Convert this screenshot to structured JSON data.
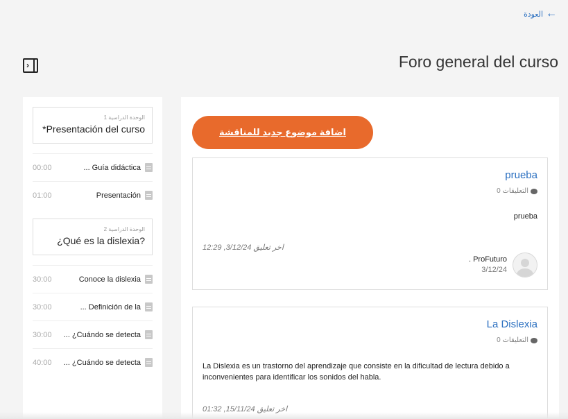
{
  "header": {
    "back_label": "العودة",
    "title": "Foro general del curso"
  },
  "sidebar": {
    "units": [
      {
        "number_label": "الوحدة الدراسية 1",
        "title": "*Presentación del curso",
        "lessons": [
          {
            "name": "... Guía didáctica",
            "duration": "00:00"
          },
          {
            "name": "Presentación",
            "duration": "01:00"
          }
        ]
      },
      {
        "number_label": "الوحدة الدراسية 2",
        "title": "¿Qué es la dislexia?",
        "lessons": [
          {
            "name": "Conoce la dislexia",
            "duration": "30:00"
          },
          {
            "name": "... Definición de la",
            "duration": "30:00"
          },
          {
            "name": "... ¿Cuándo se detecta",
            "duration": "30:00"
          },
          {
            "name": "... ¿Cuándo se detecta",
            "duration": "40:00"
          }
        ]
      }
    ]
  },
  "main": {
    "add_button_label": "اضافة موضوع جديد للمناقشة",
    "topics": [
      {
        "title": "prueba",
        "comments": "0 التعليقات",
        "body": "prueba",
        "last_comment": "اخر تعليق 3/12/24, 12:29",
        "author": ". ProFuturo",
        "date": "3/12/24"
      },
      {
        "title": "La Dislexia",
        "comments": "0 التعليقات",
        "body": "La Dislexia es un trastorno del aprendizaje que consiste en la dificultad de lectura debido a inconvenientes para identificar los sonidos del habla.",
        "last_comment": "اخر تعليق 15/11/24, 01:32"
      }
    ]
  }
}
